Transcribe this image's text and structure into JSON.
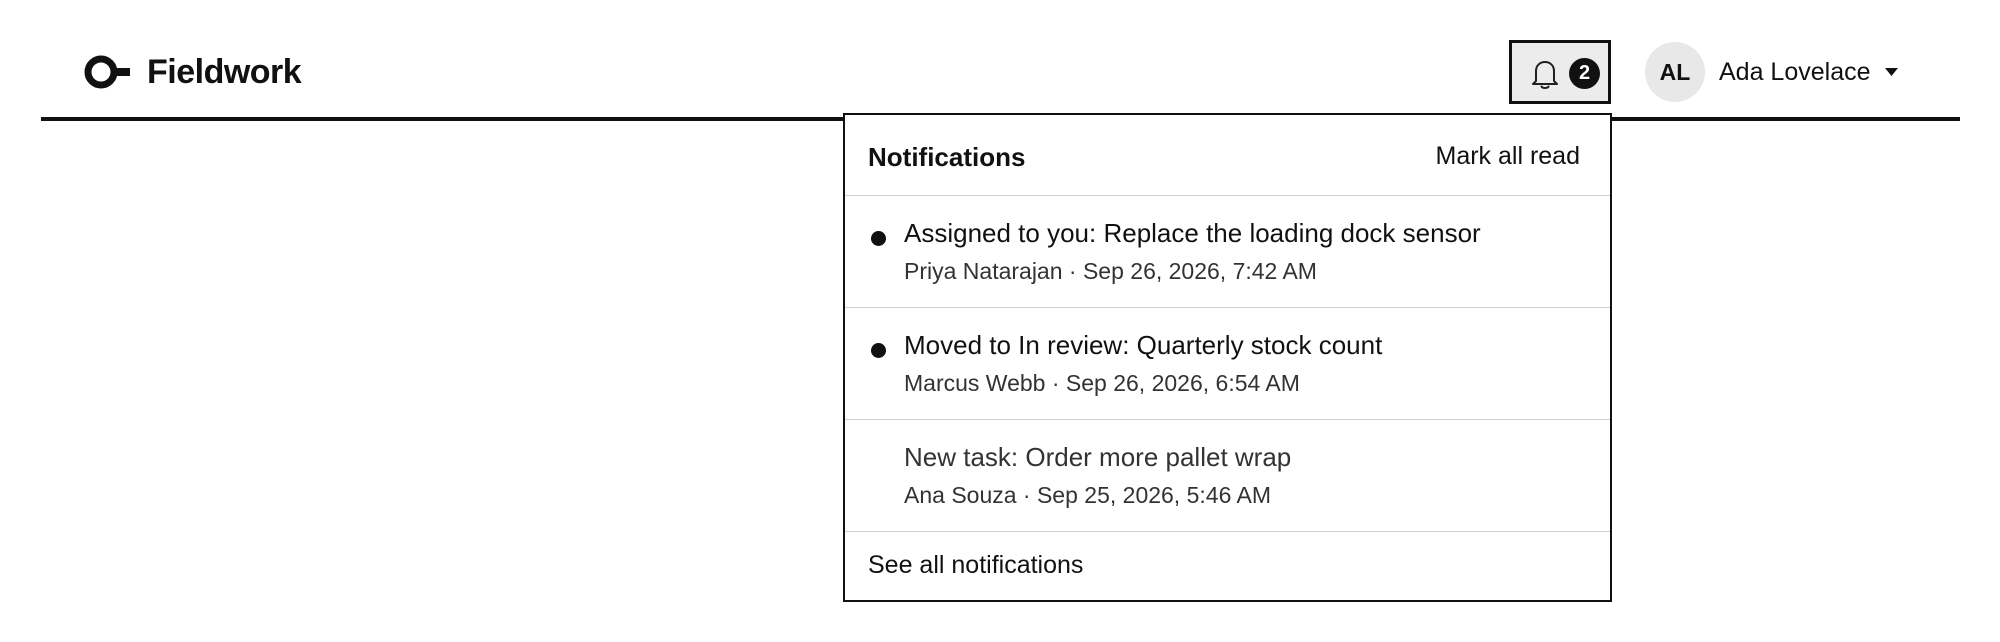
{
  "app": {
    "name": "Fieldwork"
  },
  "notifications_button": {
    "icon": "bell-icon",
    "unread_count": "2"
  },
  "user": {
    "initials": "AL",
    "name": "Ada Lovelace",
    "menu_icon": "caret-down-icon"
  },
  "notifications_panel": {
    "title": "Notifications",
    "mark_all_read_label": "Mark all read",
    "items": [
      {
        "title": "Assigned to you: Replace the loading dock sensor",
        "meta": "Priya Natarajan · Sep 26, 2026, 7:42 AM",
        "unread": true
      },
      {
        "title": "Moved to In review: Quarterly stock count",
        "meta": "Marcus Webb · Sep 26, 2026, 6:54 AM",
        "unread": true
      },
      {
        "title": "New task: Order more pallet wrap",
        "meta": "Ana Souza · Sep 25, 2026, 5:46 AM",
        "unread": false
      }
    ],
    "see_all_label": "See all notifications"
  }
}
